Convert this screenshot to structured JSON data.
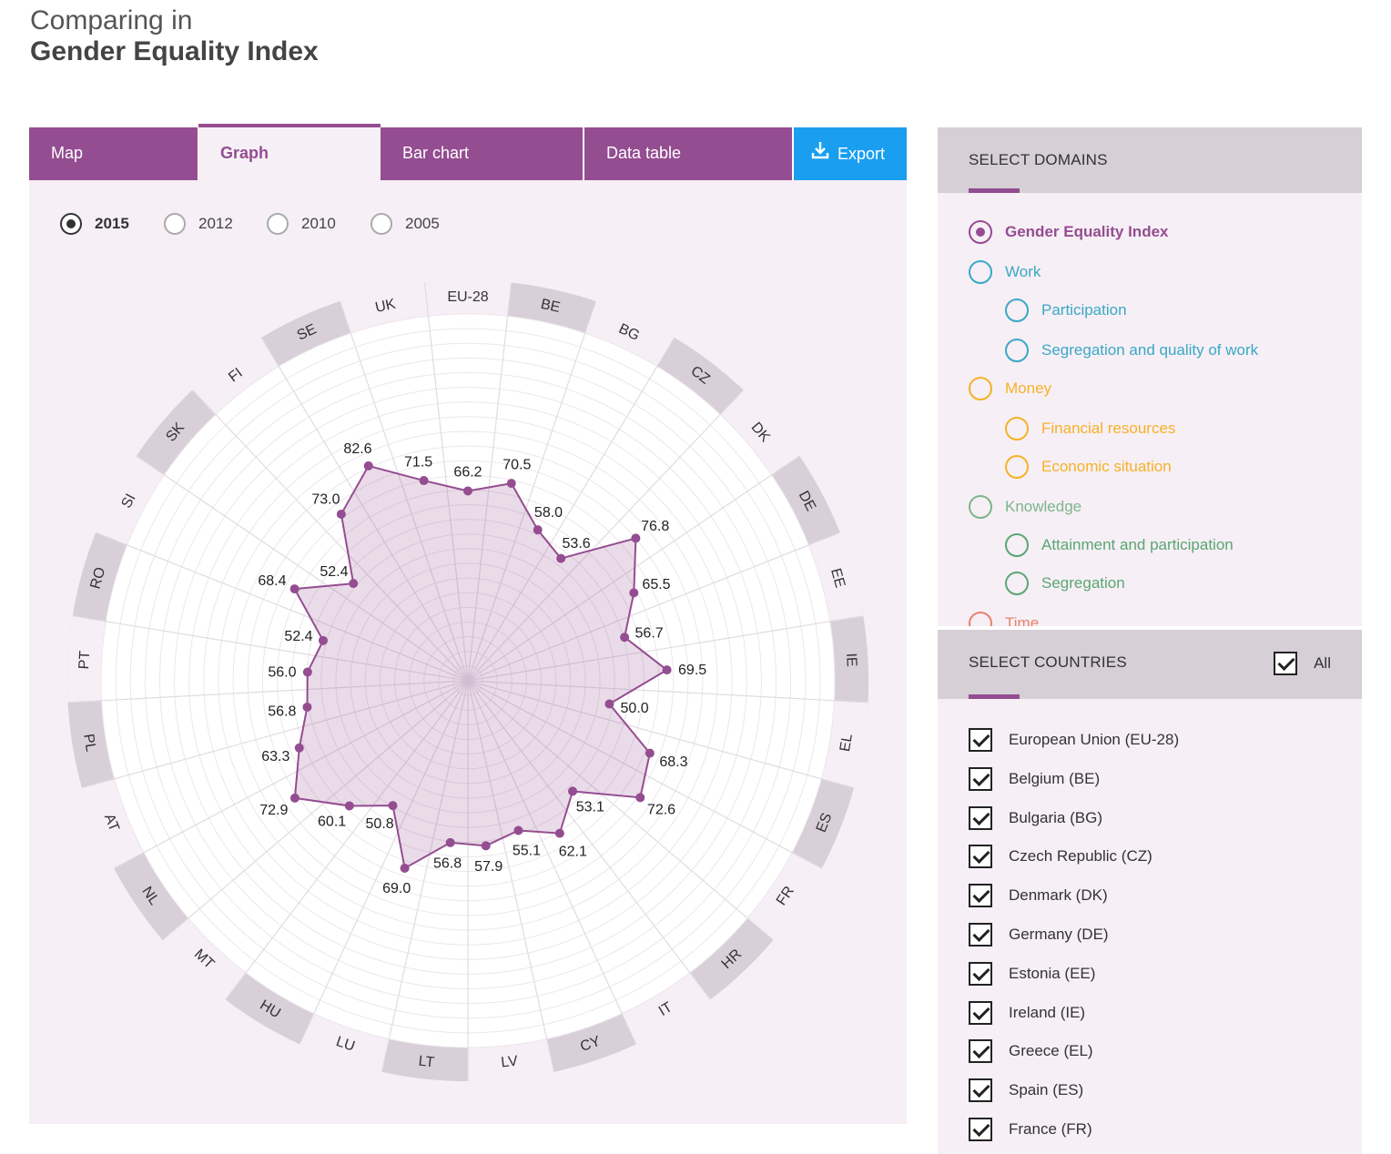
{
  "header": {
    "line1": "Comparing in",
    "line2": "Gender Equality Index"
  },
  "tabs": [
    {
      "label": "Map"
    },
    {
      "label": "Graph"
    },
    {
      "label": "Bar chart"
    },
    {
      "label": "Data table"
    }
  ],
  "export_label": "Export",
  "years": [
    "2015",
    "2012",
    "2010",
    "2005"
  ],
  "selected_year": "2015",
  "domains_title": "SELECT DOMAINS",
  "domains": [
    {
      "label": "Gender Equality Index",
      "color": "#944d91",
      "selected": true
    },
    {
      "label": "Work",
      "color": "#3aa8c6"
    },
    {
      "label": "Participation",
      "color": "#3aa8c6"
    },
    {
      "label": "Segregation and quality of work",
      "color": "#3aa8c6"
    },
    {
      "label": "Money",
      "color": "#f5b228"
    },
    {
      "label": "Financial resources",
      "color": "#f5b228"
    },
    {
      "label": "Economic situation",
      "color": "#f5b228"
    },
    {
      "label": "Knowledge",
      "color": "#7cb68a"
    },
    {
      "label": "Attainment and participation",
      "color": "#5aa672"
    },
    {
      "label": "Segregation",
      "color": "#5aa672"
    },
    {
      "label": "Time",
      "color": "#e8816a"
    }
  ],
  "countries_title": "SELECT COUNTRIES",
  "all_label": "All",
  "countries": [
    "European Union (EU-28)",
    "Belgium (BE)",
    "Bulgaria (BG)",
    "Czech Republic (CZ)",
    "Denmark (DK)",
    "Germany (DE)",
    "Estonia (EE)",
    "Ireland (IE)",
    "Greece (EL)",
    "Spain (ES)",
    "France (FR)"
  ],
  "chart_data": {
    "type": "radar",
    "series_color": "#944d91",
    "categories": [
      "EU-28",
      "BE",
      "BG",
      "CZ",
      "DK",
      "DE",
      "EE",
      "IE",
      "EL",
      "ES",
      "FR",
      "HR",
      "IT",
      "CY",
      "LV",
      "LT",
      "LU",
      "HU",
      "MT",
      "NL",
      "AT",
      "PL",
      "PT",
      "RO",
      "SI",
      "SK",
      "FI",
      "SE",
      "UK"
    ],
    "values": [
      66.2,
      70.5,
      58.0,
      53.6,
      76.8,
      65.5,
      56.7,
      69.5,
      50.0,
      68.3,
      72.6,
      53.1,
      62.1,
      55.1,
      57.9,
      56.8,
      69.0,
      50.8,
      60.1,
      72.9,
      63.3,
      56.8,
      56.0,
      52.4,
      68.4,
      52.4,
      73.0,
      82.6,
      71.5
    ]
  }
}
